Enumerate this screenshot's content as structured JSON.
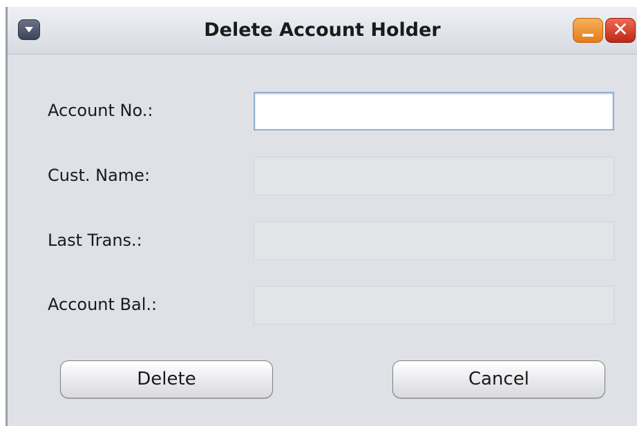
{
  "window": {
    "title": "Delete Account Holder"
  },
  "titlebar": {
    "menu_icon": "chevron-down-icon",
    "minimize_icon": "minimize-icon",
    "close_icon": "close-icon",
    "close_glyph": "✕",
    "minimize_color": "#F39A35",
    "close_color": "#D6402A"
  },
  "form": {
    "account_no": {
      "label": "Account No.:",
      "value": ""
    },
    "cust_name": {
      "label": "Cust. Name:",
      "value": ""
    },
    "last_trans": {
      "label": "Last Trans.:",
      "value": ""
    },
    "account_bal": {
      "label": "Account Bal.:",
      "value": ""
    }
  },
  "buttons": {
    "delete_label": "Delete",
    "cancel_label": "Cancel"
  }
}
